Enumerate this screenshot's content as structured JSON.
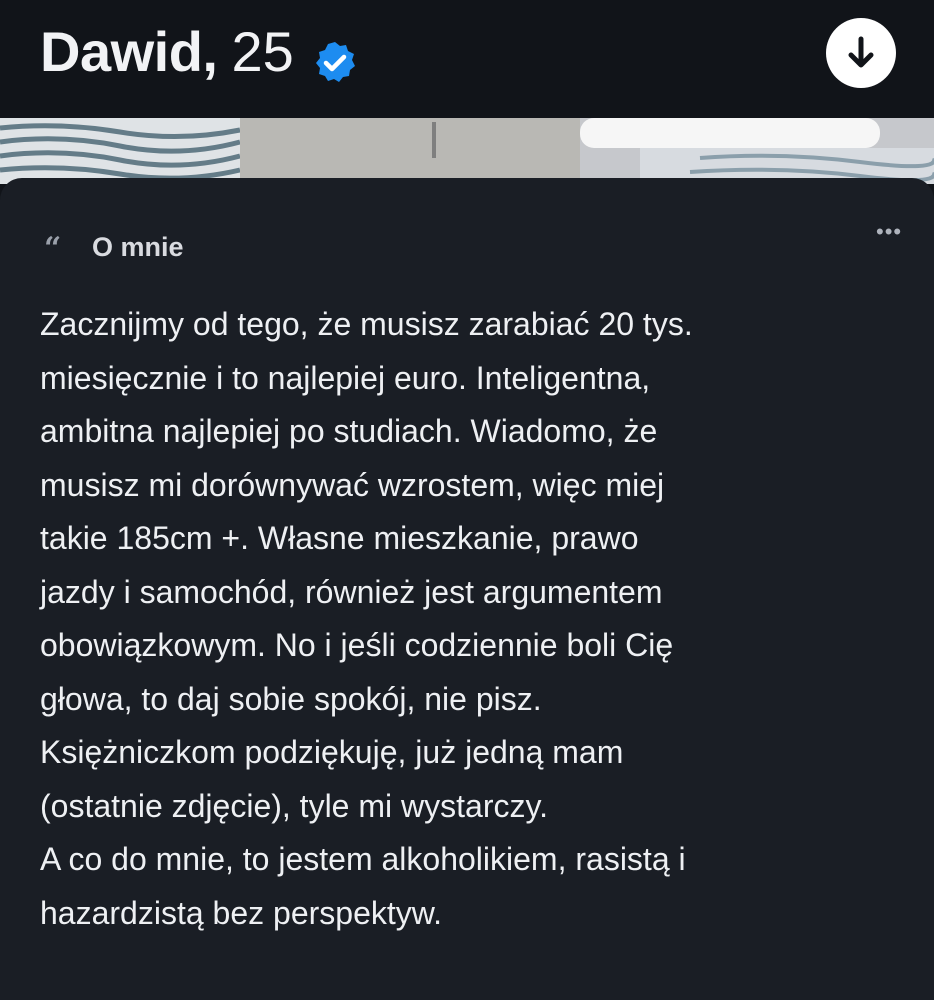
{
  "profile": {
    "name": "Dawid,",
    "age": "25",
    "verified_icon": "verified-badge-icon",
    "expand_icon": "arrow-down-icon"
  },
  "about": {
    "title": "O mnie",
    "quote_glyph": "“",
    "more_glyph": "•••",
    "lines": [
      "Zacznijmy od tego, że musisz zarabiać 20 tys.",
      "miesięcznie i to najlepiej euro. Inteligentna,",
      "ambitna najlepiej po studiach. Wiadomo, że",
      "musisz mi dorównywać wzrostem, więc miej",
      "takie 185cm +. Własne mieszkanie, prawo",
      "jazdy i samochód, również jest argumentem",
      "obowiązkowym. No i jeśli codziennie boli Cię",
      "głowa, to daj sobie spokój, nie pisz.",
      "Księżniczkom podziękuję, już jedną mam",
      "(ostatnie zdjęcie), tyle mi wystarczy.",
      "A co do mnie, to jestem alkoholikiem, rasistą i",
      "hazardzistą bez perspektyw."
    ]
  },
  "colors": {
    "background": "#111419",
    "card": "#1a1e25",
    "verified": "#1d8cf0",
    "text": "#eef0f3"
  }
}
